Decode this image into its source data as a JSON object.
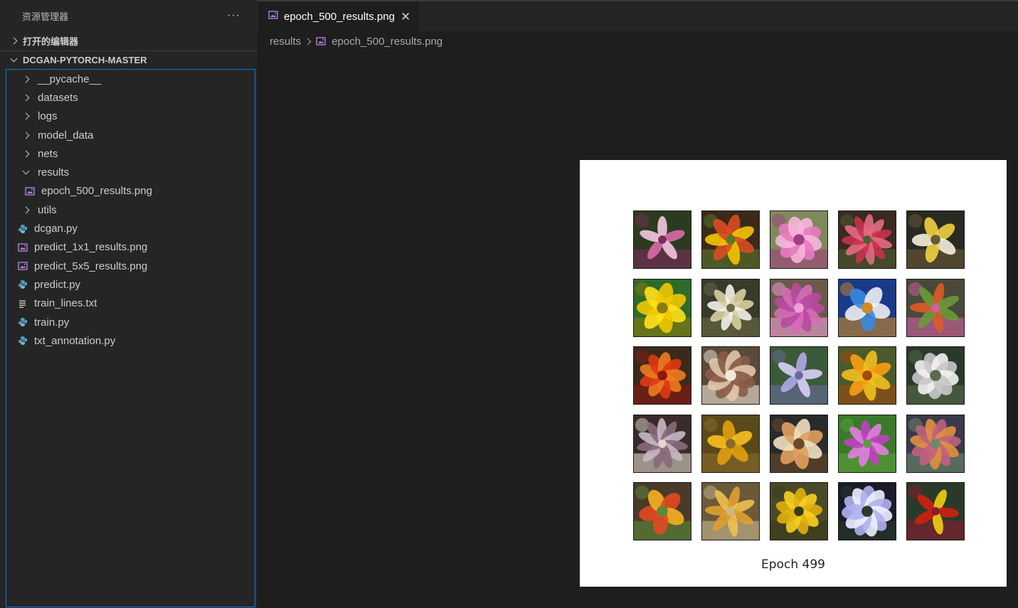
{
  "sidebar": {
    "title": "资源管理器",
    "more_icon": "ellipsis-icon",
    "open_editors_label": "打开的编辑器",
    "project_label": "DCGAN-PYTORCH-MASTER",
    "items": [
      {
        "label": "__pycache__",
        "kind": "folder",
        "expanded": false
      },
      {
        "label": "datasets",
        "kind": "folder",
        "expanded": false
      },
      {
        "label": "logs",
        "kind": "folder",
        "expanded": false
      },
      {
        "label": "model_data",
        "kind": "folder",
        "expanded": false
      },
      {
        "label": "nets",
        "kind": "folder",
        "expanded": false
      },
      {
        "label": "results",
        "kind": "folder",
        "expanded": true
      },
      {
        "label": "epoch_500_results.png",
        "kind": "image",
        "child": true
      },
      {
        "label": "utils",
        "kind": "folder",
        "expanded": false
      },
      {
        "label": "dcgan.py",
        "kind": "python"
      },
      {
        "label": "predict_1x1_results.png",
        "kind": "image"
      },
      {
        "label": "predict_5x5_results.png",
        "kind": "image"
      },
      {
        "label": "predict.py",
        "kind": "python"
      },
      {
        "label": "train_lines.txt",
        "kind": "text"
      },
      {
        "label": "train.py",
        "kind": "python"
      },
      {
        "label": "txt_annotation.py",
        "kind": "python"
      }
    ]
  },
  "editor": {
    "tab_label": "epoch_500_results.png",
    "breadcrumb": [
      "results",
      "epoch_500_results.png"
    ]
  },
  "preview": {
    "caption": "Epoch 499",
    "grid_rows": 5,
    "grid_cols": 5
  },
  "colors": {
    "image_icon": "#b180d7",
    "python_icon": "#519aba",
    "accent_border": "#0a7bd6"
  }
}
